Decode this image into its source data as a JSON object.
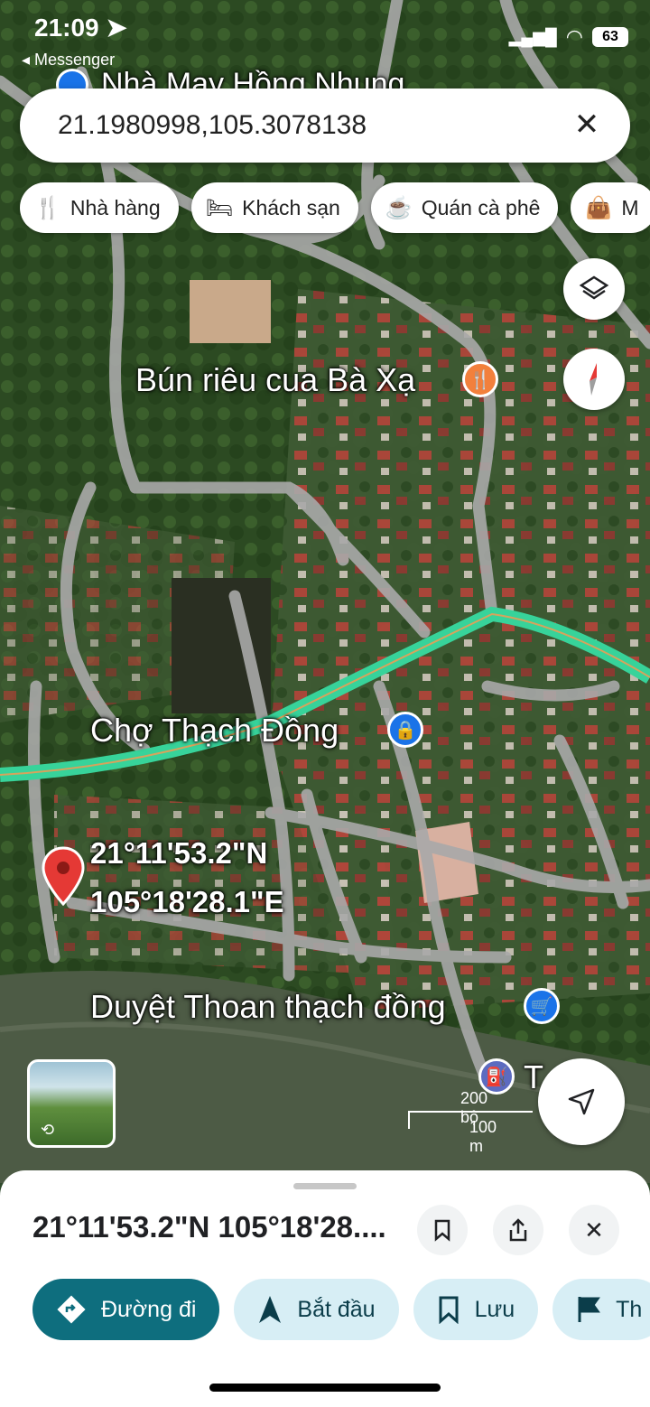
{
  "status_bar": {
    "time": "21:09",
    "back_app": "◂ Messenger",
    "battery": "63"
  },
  "search": {
    "value": "21.1980998,105.3078138"
  },
  "chips": [
    {
      "icon": "fork-knife-icon",
      "glyph": "🍴",
      "label": "Nhà hàng"
    },
    {
      "icon": "bed-icon",
      "glyph": "🛏",
      "label": "Khách sạn"
    },
    {
      "icon": "coffee-icon",
      "glyph": "☕",
      "label": "Quán cà phê"
    },
    {
      "icon": "shopping-bag-icon",
      "glyph": "👜",
      "label": "M"
    }
  ],
  "map": {
    "places": {
      "top_partial": "Nhà May Hồng Nhung",
      "restaurant": "Bún riêu cua Bà Xạ",
      "market": "Chợ Thạch Đồng",
      "shop": "Duyệt Thoan thạch đồng",
      "bottom_partial": "T... bo"
    },
    "dropped_pin": {
      "lat": "21°11'53.2\"N",
      "lng": "105°18'28.1\"E"
    },
    "scale": {
      "imperial": "200 bộ",
      "metric": "100 m"
    },
    "colors": {
      "highway": "#37d39a",
      "road": "#a9a9a9",
      "water": "#4d5b45",
      "pin": "#e53935"
    }
  },
  "sheet": {
    "title": "21°11'53.2\"N 105°18'28....",
    "actions": [
      {
        "icon": "directions-icon",
        "label": "Đường đi"
      },
      {
        "icon": "navigation-arrow-icon",
        "label": "Bắt đầu"
      },
      {
        "icon": "bookmark-icon",
        "label": "Lưu"
      },
      {
        "icon": "flag-icon",
        "label": "Th"
      }
    ]
  }
}
